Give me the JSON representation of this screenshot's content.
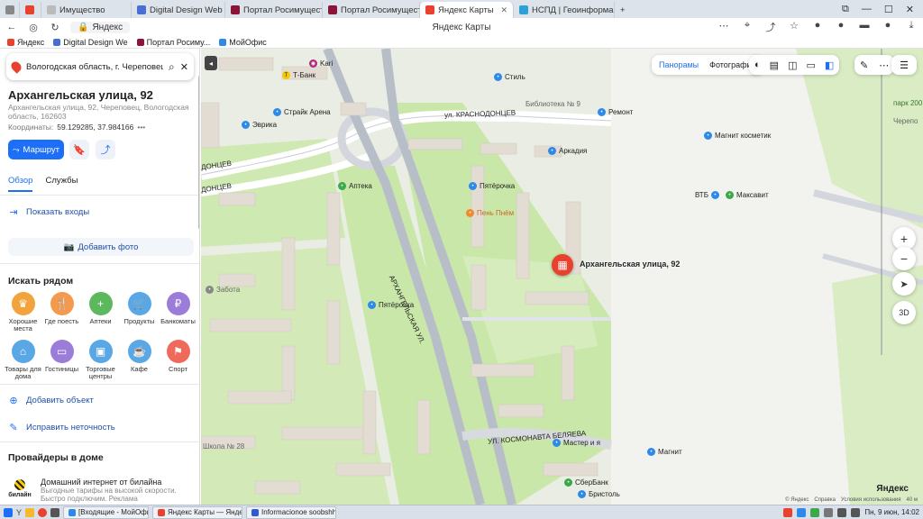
{
  "browser": {
    "tabs": [
      {
        "label": "",
        "color": "#888"
      },
      {
        "label": "",
        "color": "#e8412d"
      },
      {
        "label": "Имущество",
        "color": "#bbb"
      },
      {
        "label": "Digital Design Web Client",
        "color": "#4a6fd3"
      },
      {
        "label": "Портал Росимущества",
        "color": "#8a1538"
      },
      {
        "label": "Портал Росимущества",
        "color": "#8a1538"
      },
      {
        "label": "Яндекс Карты",
        "color": "#e8412d",
        "active": true
      },
      {
        "label": "НСПД | Геоинформацио",
        "color": "#2da0d6"
      }
    ],
    "url": "Яндекс",
    "page_title": "Яндекс Карты",
    "bookmarks": [
      {
        "label": "Яндекс",
        "color": "#e8412d"
      },
      {
        "label": "Digital Design We",
        "color": "#4a6fd3"
      },
      {
        "label": "Портал Росиму...",
        "color": "#8a1538"
      },
      {
        "label": "МойОфис",
        "color": "#2d8ae8"
      }
    ]
  },
  "panel": {
    "search_value": "Вологодская область, г. Череповец, у",
    "title": "Архангельская улица, 92",
    "subtitle": "Архангельская улица, 92, Череповец, Вологодская область, 162603",
    "coords_label": "Координаты:",
    "coords_value": "59.129285, 37.984166",
    "coords_more": "•••",
    "route_label": "Маршрут",
    "tabs": [
      "Обзор",
      "Службы"
    ],
    "show_entrances": "Показать входы",
    "add_photo": "Добавить фото",
    "nearby_title": "Искать рядом",
    "nearby": [
      {
        "label": "Хорошие места",
        "color": "#f3a33b",
        "glyph": "♛"
      },
      {
        "label": "Где поесть",
        "color": "#f39a4e",
        "glyph": "🍴"
      },
      {
        "label": "Аптеки",
        "color": "#5cb85c",
        "glyph": "+"
      },
      {
        "label": "Продукты",
        "color": "#5aa7e6",
        "glyph": "🛒"
      },
      {
        "label": "Банкоматы",
        "color": "#9b7cd9",
        "glyph": "₽"
      },
      {
        "label": "Товары для дома",
        "color": "#5aa7e6",
        "glyph": "⌂"
      },
      {
        "label": "Гостиницы",
        "color": "#9b7cd9",
        "glyph": "▭"
      },
      {
        "label": "Торговые центры",
        "color": "#5aa7e6",
        "glyph": "▣"
      },
      {
        "label": "Кафе",
        "color": "#5aa7e6",
        "glyph": "☕"
      },
      {
        "label": "Спорт",
        "color": "#f06a5c",
        "glyph": "⚑"
      }
    ],
    "add_object": "Добавить объект",
    "fix_error": "Исправить неточность",
    "providers_title": "Провайдеры в доме",
    "provider_name": "Домашний интернет от билайна",
    "provider_desc": "Выгодные тарифы на высокой скорости. Быстро подключим. Реклама",
    "provider_logo": "билайн"
  },
  "map": {
    "toolbar": {
      "panoramas": "Панорамы",
      "photos": "Фотографии"
    },
    "marker_label": "Архангельская улица, 92",
    "zoom_3d": "3D",
    "logo": "Яндекс",
    "footer": [
      "© Яндекс",
      "Справка",
      "Условия использования"
    ],
    "scale": "40 м",
    "streets": [
      {
        "text": "ул. КРАСНОДОНЦЕВ"
      },
      {
        "text": "АРХАНГЕЛЬСКАЯ УЛ."
      },
      {
        "text": "УЛ. КОСМОНАВТА БЕЛЯЕВА"
      },
      {
        "text": "ДОНЦЕВ"
      },
      {
        "text": "ДОНЦЕВ"
      }
    ],
    "pois": [
      {
        "text": "Т-Банк",
        "color": "#f5c800"
      },
      {
        "text": "Kari",
        "color": "#b0287a"
      },
      {
        "text": "Стиль",
        "color": "#2d8ae8"
      },
      {
        "text": "Страйк Арена",
        "color": "#2d8ae8"
      },
      {
        "text": "Эврика",
        "color": "#2d8ae8"
      },
      {
        "text": "Библиотека № 9",
        "color": "#888"
      },
      {
        "text": "Ремонт",
        "color": "#2d8ae8"
      },
      {
        "text": "Магнит косметик",
        "color": "#2d8ae8"
      },
      {
        "text": "Аркадия",
        "color": "#2d8ae8"
      },
      {
        "text": "Аптека",
        "color": "#3aa84b"
      },
      {
        "text": "Пятёрочка",
        "color": "#2d8ae8"
      },
      {
        "text": "Пень Пнём",
        "color": "#f08a2d"
      },
      {
        "text": "ВТБ",
        "color": "#2d8ae8"
      },
      {
        "text": "Максавит",
        "color": "#3aa84b"
      },
      {
        "text": "Пятёрочка",
        "color": "#2d8ae8"
      },
      {
        "text": "Забота",
        "color": "#888"
      },
      {
        "text": "Мастер и я",
        "color": "#2d8ae8"
      },
      {
        "text": "Магнит",
        "color": "#2d8ae8"
      },
      {
        "text": "Школа № 28",
        "color": "#888"
      },
      {
        "text": "СберБанк",
        "color": "#3aa84b"
      },
      {
        "text": "Бристоль",
        "color": "#2d8ae8"
      },
      {
        "text": "парк 200",
        "color": "#3aa84b"
      },
      {
        "text": "Черепо",
        "color": "#888"
      }
    ]
  },
  "taskbar": {
    "items": [
      {
        "label": "[Входящие - МойОфис П...",
        "color": "#2d8ae8"
      },
      {
        "label": "Яндекс Карты — Яндекс ...",
        "color": "#e8412d"
      },
      {
        "label": "Informacionoe soobshhe...",
        "color": "#2d5bd6"
      }
    ],
    "clock": "Пн, 9 июн, 14:02"
  }
}
